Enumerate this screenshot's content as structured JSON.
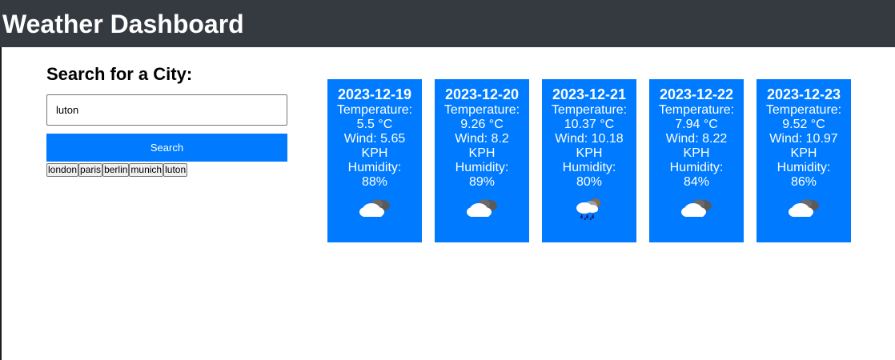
{
  "header": {
    "title": "Weather Dashboard"
  },
  "search": {
    "title": "Search for a City:",
    "input_value": "luton",
    "button_label": "Search",
    "history": [
      "london",
      "paris",
      "berlin",
      "munich",
      "luton"
    ]
  },
  "forecast": [
    {
      "date": "2023-12-19",
      "temp_label": "Temperature:",
      "temp": "5.5 °C",
      "wind_line1": "Wind: 5.65",
      "wind_line2": "KPH",
      "humidity_label": "Humidity:",
      "humidity": "88%",
      "icon": "cloudy-icon"
    },
    {
      "date": "2023-12-20",
      "temp_label": "Temperature:",
      "temp": "9.26 °C",
      "wind_line1": "Wind: 8.2",
      "wind_line2": "KPH",
      "humidity_label": "Humidity:",
      "humidity": "89%",
      "icon": "cloudy-icon"
    },
    {
      "date": "2023-12-21",
      "temp_label": "Temperature:",
      "temp": "10.37 °C",
      "wind_line1": "Wind: 10.18",
      "wind_line2": "KPH",
      "humidity_label": "Humidity:",
      "humidity": "80%",
      "icon": "rain-icon"
    },
    {
      "date": "2023-12-22",
      "temp_label": "Temperature:",
      "temp": "7.94 °C",
      "wind_line1": "Wind: 8.22",
      "wind_line2": "KPH",
      "humidity_label": "Humidity:",
      "humidity": "84%",
      "icon": "cloudy-icon"
    },
    {
      "date": "2023-12-23",
      "temp_label": "Temperature:",
      "temp": "9.52 °C",
      "wind_line1": "Wind: 10.97",
      "wind_line2": "KPH",
      "humidity_label": "Humidity:",
      "humidity": "86%",
      "icon": "cloudy-icon"
    }
  ],
  "colors": {
    "header_bg": "#343a40",
    "accent": "#007bff"
  }
}
